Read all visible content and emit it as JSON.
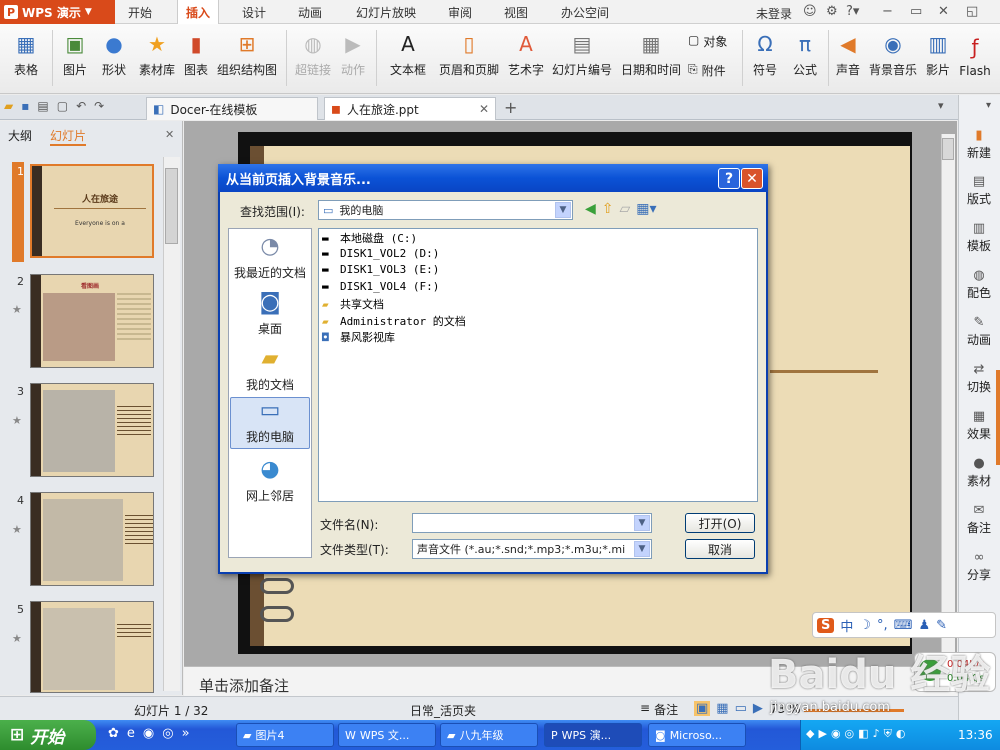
{
  "app": {
    "name": "WPS 演示",
    "menu": [
      "开始",
      "插入",
      "设计",
      "动画",
      "幻灯片放映",
      "审阅",
      "视图",
      "办公空间"
    ],
    "active_menu": "插入",
    "login": "未登录"
  },
  "ribbon": [
    {
      "label": "表格",
      "icon": "table-icon",
      "dropdown": true
    },
    {
      "label": "图片",
      "icon": "picture-icon"
    },
    {
      "label": "形状",
      "icon": "shape-icon",
      "dropdown": true
    },
    {
      "label": "素材库",
      "icon": "star-icon"
    },
    {
      "label": "图表",
      "icon": "chart-icon"
    },
    {
      "label": "组织结构图",
      "icon": "org-chart-icon"
    },
    {
      "label": "超链接",
      "icon": "hyperlink-icon",
      "disabled": true
    },
    {
      "label": "动作",
      "icon": "action-icon",
      "disabled": true
    },
    {
      "label": "文本框",
      "icon": "textbox-icon",
      "dropdown": true
    },
    {
      "label": "页眉和页脚",
      "icon": "header-footer-icon"
    },
    {
      "label": "艺术字",
      "icon": "wordart-icon"
    },
    {
      "label": "幻灯片编号",
      "icon": "slide-number-icon"
    },
    {
      "label": "日期和时间",
      "icon": "date-time-icon"
    },
    {
      "label": "对象",
      "icon": "object-icon"
    },
    {
      "label": "附件",
      "icon": "attachment-icon"
    },
    {
      "label": "符号",
      "icon": "omega-icon",
      "dropdown": true
    },
    {
      "label": "公式",
      "icon": "pi-icon"
    },
    {
      "label": "声音",
      "icon": "sound-icon"
    },
    {
      "label": "背景音乐",
      "icon": "music-cd-icon"
    },
    {
      "label": "影片",
      "icon": "film-icon"
    },
    {
      "label": "Flash",
      "icon": "flash-icon"
    }
  ],
  "doc_tabs": [
    "Docer-在线模板",
    "人在旅途.ppt"
  ],
  "left_panel": {
    "tabs": [
      "大纲",
      "幻灯片"
    ],
    "thumbs": [
      {
        "num": "1",
        "title": "人在旅途",
        "sub": "Everyone is on a"
      },
      {
        "num": "2",
        "title": "看图画",
        "sub": ""
      },
      {
        "num": "3",
        "title": "",
        "sub": ""
      },
      {
        "num": "4",
        "title": "",
        "sub": ""
      },
      {
        "num": "5",
        "title": "",
        "sub": ""
      }
    ]
  },
  "notes_placeholder": "单击添加备注",
  "status": {
    "slide_info": "幻灯片 1 / 32",
    "theme": "日常_活页夹",
    "notes_btn": "备注",
    "zoom": "73 %"
  },
  "right_sidebar": [
    "新建",
    "版式",
    "模板",
    "配色",
    "动画",
    "切换",
    "效果",
    "素材",
    "备注",
    "分享"
  ],
  "dialog": {
    "title": "从当前页插入背景音乐...",
    "lookin_label": "查找范围(I):",
    "lookin_value": "我的电脑",
    "places": [
      "我最近的文档",
      "桌面",
      "我的文档",
      "我的电脑",
      "网上邻居"
    ],
    "selected_place": "我的电脑",
    "files": [
      {
        "name": "本地磁盘 (C:)",
        "icon": "drive-icon"
      },
      {
        "name": "DISK1_VOL2 (D:)",
        "icon": "drive-icon"
      },
      {
        "name": "DISK1_VOL3 (E:)",
        "icon": "drive-icon"
      },
      {
        "name": "DISK1_VOL4 (F:)",
        "icon": "drive-icon"
      },
      {
        "name": "共享文档",
        "icon": "folder-icon"
      },
      {
        "name": "Administrator 的文档",
        "icon": "folder-icon"
      },
      {
        "name": "暴风影视库",
        "icon": "media-library-icon"
      }
    ],
    "filename_label": "文件名(N):",
    "filename_value": "",
    "filetype_label": "文件类型(T):",
    "filetype_value": "声音文件 (*.au;*.snd;*.mp3;*.m3u;*.mi",
    "open_btn": "打开(O)",
    "cancel_btn": "取消"
  },
  "taskbar": {
    "start": "开始",
    "tasks": [
      "图片4",
      "WPS 文...",
      "八九年级",
      "WPS 演...",
      "Microso..."
    ],
    "active_task": "WPS 演...",
    "clock": "13:36"
  },
  "netmon": {
    "up": "0.04K/s",
    "down": "0.04K/s"
  },
  "watermark": {
    "text": "Baidu 经验",
    "url": "jingyan.baidu.com"
  }
}
